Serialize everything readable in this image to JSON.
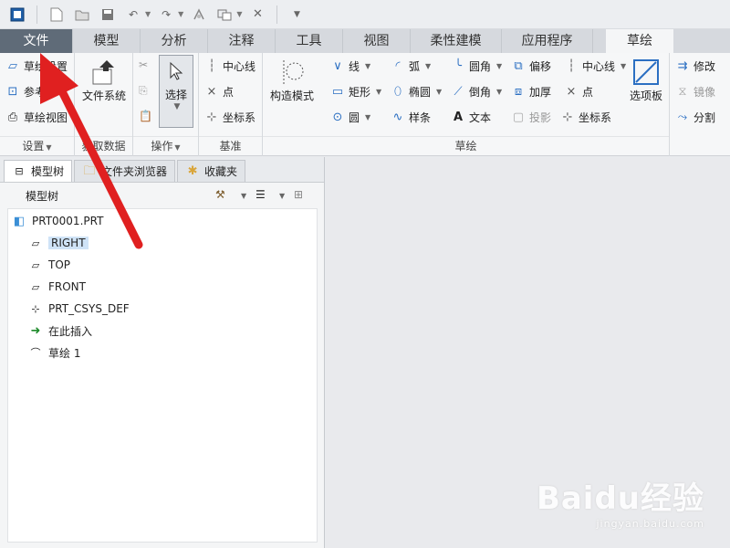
{
  "quick_access": {
    "icons": [
      "window-icon",
      "new-icon",
      "open-icon",
      "save-icon",
      "undo-icon",
      "redo-icon",
      "regenerate-icon",
      "windows-icon",
      "close-icon",
      "customize-icon"
    ]
  },
  "tabs": [
    {
      "label": "文件"
    },
    {
      "label": "模型"
    },
    {
      "label": "分析"
    },
    {
      "label": "注释"
    },
    {
      "label": "工具"
    },
    {
      "label": "视图"
    },
    {
      "label": "柔性建模"
    },
    {
      "label": "应用程序"
    },
    {
      "label": "草绘"
    }
  ],
  "ribbon": {
    "setup": {
      "sketch_setup": "草绘设置",
      "references": "参考",
      "sketch_view": "草绘视图",
      "label": "设置"
    },
    "get_data": {
      "file_system": "文件系统",
      "label": "获取数据"
    },
    "operations": {
      "select": "选择",
      "label": "操作"
    },
    "datum": {
      "centerline": "中心线",
      "point": "点",
      "csys": "坐标系",
      "label": "基准"
    },
    "sketching": {
      "construction_mode": "构造模式",
      "line": "线",
      "arc": "弧",
      "fillet": "圆角",
      "offset": "偏移",
      "centerline": "中心线",
      "rectangle": "矩形",
      "ellipse": "椭圆",
      "chamfer": "倒角",
      "thicken": "加厚",
      "point": "点",
      "circle": "圆",
      "spline": "样条",
      "text": "文本",
      "project": "投影",
      "csys": "坐标系",
      "palette": "选项板",
      "label": "草绘"
    },
    "editing": {
      "modify": "修改",
      "mirror": "镜像",
      "divide": "分割"
    }
  },
  "panel": {
    "tabs": [
      "模型树",
      "文件夹浏览器",
      "收藏夹"
    ],
    "title": "模型树",
    "tree": [
      {
        "label": "PRT0001.PRT"
      },
      {
        "label": "RIGHT"
      },
      {
        "label": "TOP"
      },
      {
        "label": "FRONT"
      },
      {
        "label": "PRT_CSYS_DEF"
      },
      {
        "label": "在此插入"
      },
      {
        "label": "草绘 1"
      }
    ]
  },
  "watermark": {
    "logo": "Baidu经验",
    "url": "jingyan.baidu.com"
  },
  "colors": {
    "file_tab": "#5f6b78",
    "accent": "#2b6fc2",
    "arrow": "#e02020"
  }
}
